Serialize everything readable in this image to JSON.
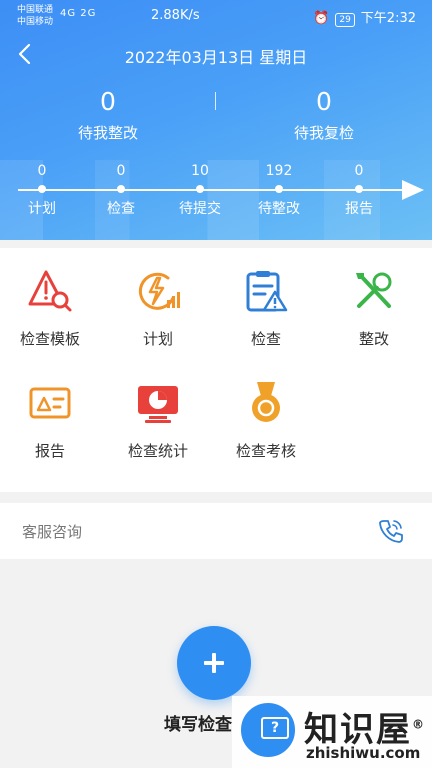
{
  "statusbar": {
    "carrier1": "中国联通",
    "carrier2": "中国移动",
    "signal": "4G 2G",
    "net_speed": "2.88K/s",
    "battery": "29",
    "time": "下午2:32"
  },
  "header": {
    "date": "2022年03月13日 星期日",
    "stats": [
      {
        "value": "0",
        "label": "待我整改"
      },
      {
        "value": "0",
        "label": "待我复检"
      }
    ],
    "timeline": [
      {
        "count": "0",
        "label": "计划"
      },
      {
        "count": "0",
        "label": "检查"
      },
      {
        "count": "10",
        "label": "待提交"
      },
      {
        "count": "192",
        "label": "待整改"
      },
      {
        "count": "0",
        "label": "报告"
      }
    ]
  },
  "menu": {
    "items": [
      {
        "label": "检查模板",
        "icon": "warning-magnifier-icon"
      },
      {
        "label": "计划",
        "icon": "lightning-chart-icon"
      },
      {
        "label": "检查",
        "icon": "clipboard-warning-icon"
      },
      {
        "label": "整改",
        "icon": "tools-icon"
      },
      {
        "label": "报告",
        "icon": "report-card-icon"
      },
      {
        "label": "检查统计",
        "icon": "monitor-pie-icon"
      },
      {
        "label": "检查考核",
        "icon": "medal-icon"
      }
    ]
  },
  "service": {
    "label": "客服咨询",
    "icon": "phone-icon"
  },
  "fab": {
    "label": "填写检查"
  },
  "watermark": {
    "title": "知识屋",
    "url": "zhishiwu.com",
    "reg": "®"
  },
  "colors": {
    "primary": "#2f8ef2",
    "header_start": "#3d8ef5",
    "header_end": "#6cc0f5",
    "red": "#e8413b",
    "orange": "#f0942a",
    "green": "#3bb54a",
    "blue": "#2f7fd6"
  }
}
